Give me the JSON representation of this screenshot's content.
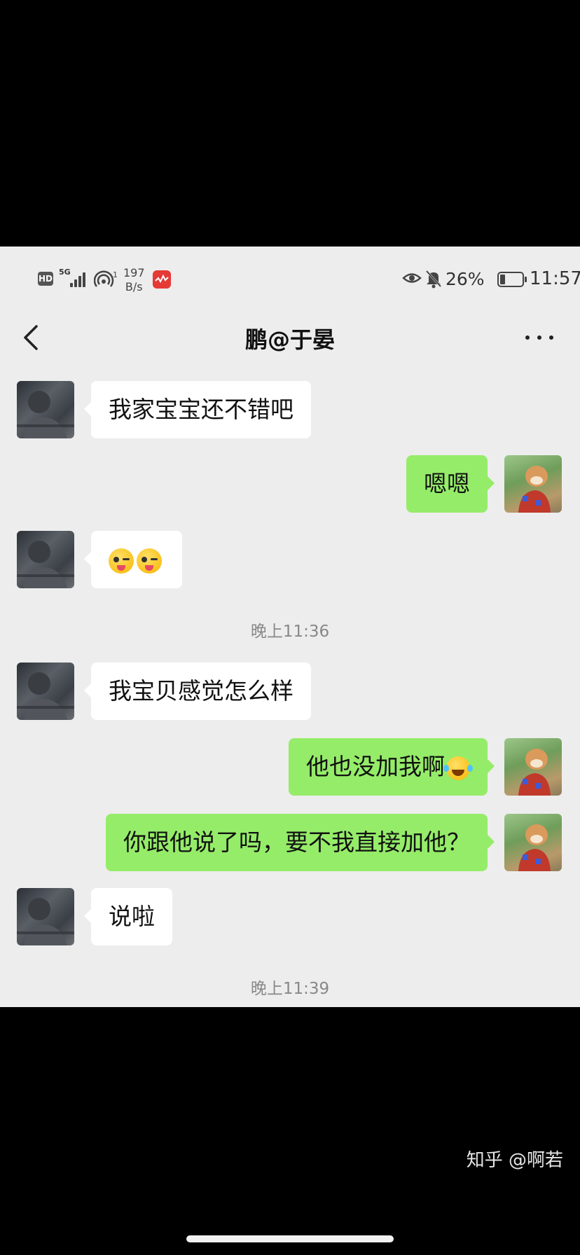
{
  "status_bar": {
    "network_type": "5G",
    "net_speed_value": "197",
    "net_speed_unit": "B/s",
    "battery_pct": "26%",
    "battery_level": 0.26,
    "time": "11:57",
    "icons": [
      "hd-icon",
      "signal-icon",
      "hotspot-icon",
      "app-notification-icon",
      "eye-icon",
      "mute-bell-icon",
      "battery-icon"
    ]
  },
  "nav": {
    "title": "鹏@于晏"
  },
  "messages": [
    {
      "side": "left",
      "text": "我家宝宝还不错吧"
    },
    {
      "side": "right",
      "text": "嗯嗯"
    },
    {
      "side": "left",
      "text": "",
      "emojis": [
        "winking-tongue-emoji",
        "winking-tongue-emoji"
      ]
    },
    {
      "side": "right",
      "text": "他也没加我啊",
      "trailing_emoji": "tears-of-joy-emoji"
    },
    {
      "side": "right",
      "text": "你跟他说了吗，要不我直接加他？"
    },
    {
      "side": "left",
      "text": "我宝贝感觉怎么样"
    },
    {
      "side": "left",
      "text": "说啦"
    }
  ],
  "timestamps": {
    "t1": "晚上11:36",
    "t2": "晚上11:39"
  },
  "watermark": "知乎 @啊若",
  "colors": {
    "chat_bg": "#ededed",
    "bubble_self": "#95ec69",
    "bubble_other": "#ffffff"
  }
}
